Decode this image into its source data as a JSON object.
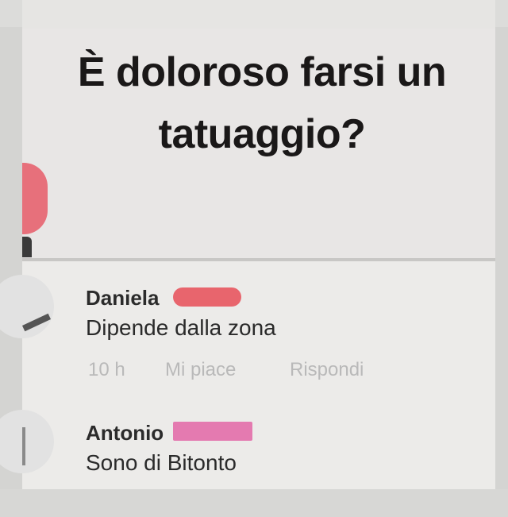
{
  "post": {
    "title_line1": "È doloroso farsi un",
    "title_line2": "tatuaggio?"
  },
  "comments": [
    {
      "author": "Daniela",
      "text": "Dipende dalla zona",
      "time": "10 h",
      "like_label": "Mi piace",
      "reply_label": "Rispondi",
      "redaction_color": "#e8656d"
    },
    {
      "author": "Antonio",
      "text": "Sono di Bitonto",
      "redaction_color": "#e47ab0"
    }
  ]
}
